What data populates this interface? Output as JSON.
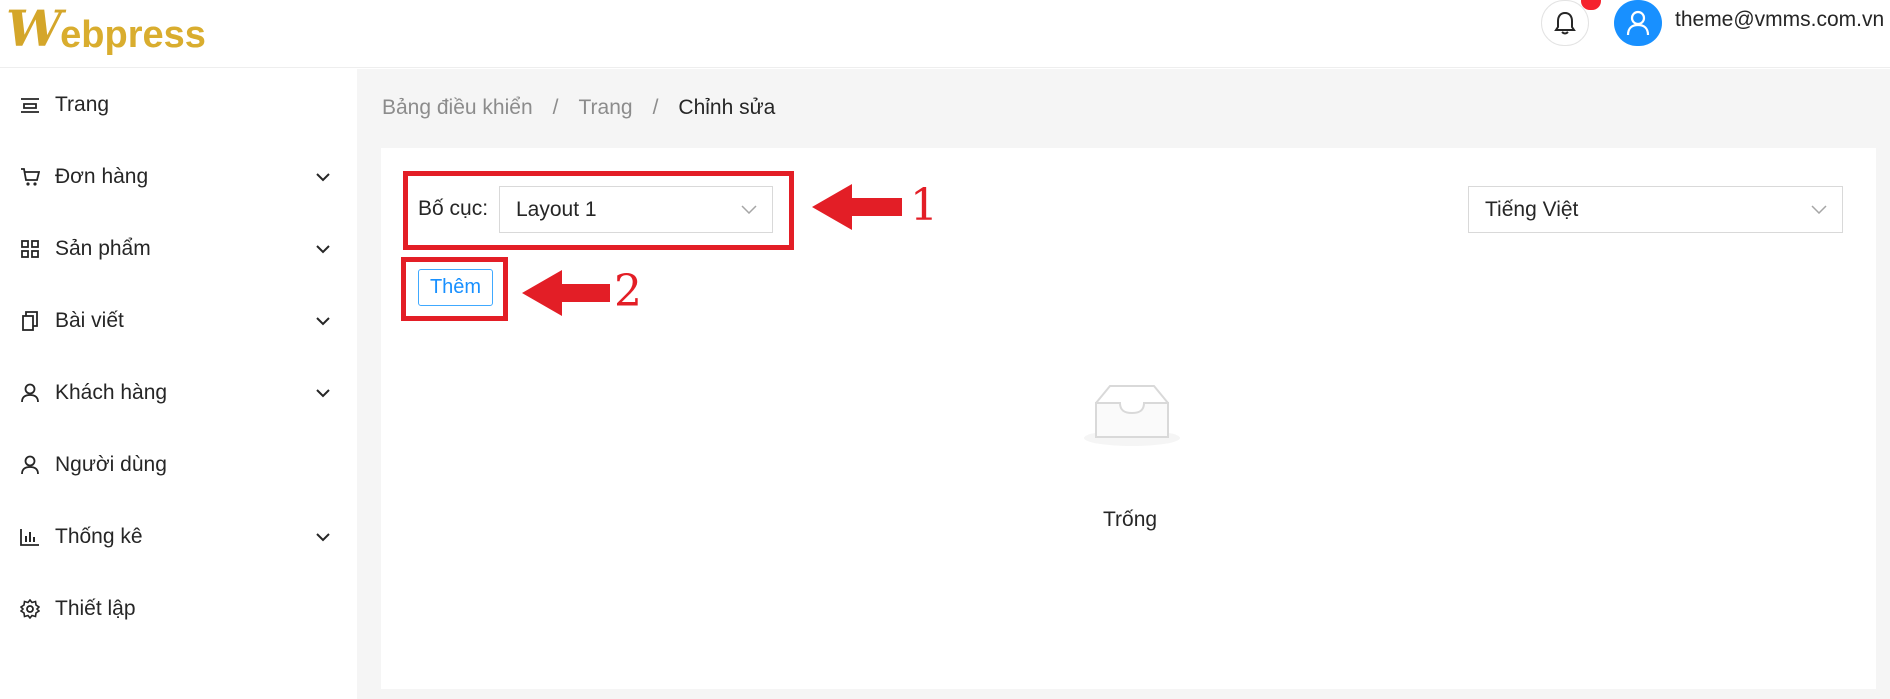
{
  "header": {
    "logo_mark": "W",
    "logo_text": "ebpress",
    "user_email": "theme@vmms.com.vn"
  },
  "sidebar": {
    "items": [
      {
        "label": "Trang",
        "icon": "page-icon",
        "expandable": false
      },
      {
        "label": "Đơn hàng",
        "icon": "cart-icon",
        "expandable": true
      },
      {
        "label": "Sản phẩm",
        "icon": "grid-icon",
        "expandable": true
      },
      {
        "label": "Bài viết",
        "icon": "copy-icon",
        "expandable": true
      },
      {
        "label": "Khách hàng",
        "icon": "user-icon",
        "expandable": true
      },
      {
        "label": "Người dùng",
        "icon": "user-icon",
        "expandable": false
      },
      {
        "label": "Thống kê",
        "icon": "bar-chart-icon",
        "expandable": true
      },
      {
        "label": "Thiết lập",
        "icon": "gear-icon",
        "expandable": false
      }
    ]
  },
  "breadcrumb": {
    "items": [
      "Bảng điều khiển",
      "Trang",
      "Chỉnh sửa"
    ],
    "separator": "/"
  },
  "form": {
    "layout_label": "Bố cục:",
    "layout_value": "Layout 1",
    "language_value": "Tiếng Việt",
    "add_label": "Thêm"
  },
  "empty": {
    "text": "Trống"
  },
  "annotations": {
    "one": "1",
    "two": "2",
    "color": "#e31e26"
  },
  "colors": {
    "primary": "#1890ff",
    "brand": "#d9ad2e",
    "badge": "#f5222d"
  }
}
